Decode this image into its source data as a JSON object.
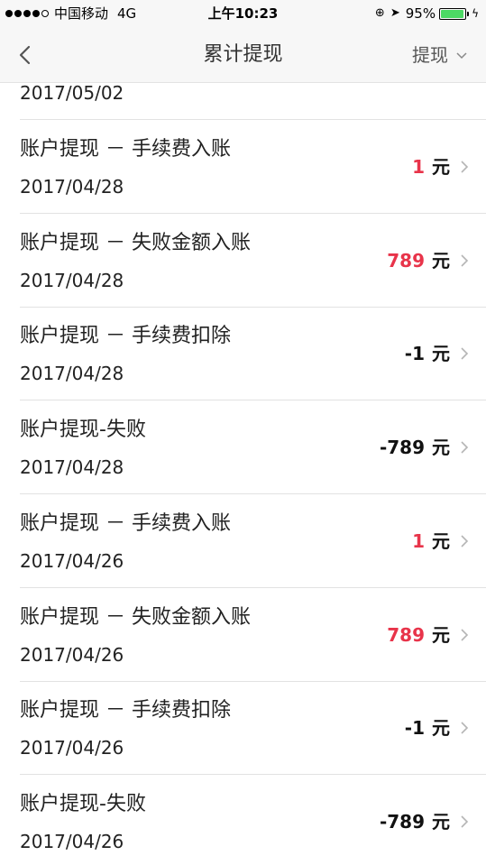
{
  "status_bar": {
    "carrier": "中国移动",
    "network": "4G",
    "time": "上午10:23",
    "battery": "95%",
    "battery_level": 0.95
  },
  "nav": {
    "title": "累计提现",
    "filter_label": "提现"
  },
  "partial_date": "2017/05/02",
  "colors": {
    "positive": "#e8344a",
    "negative": "#111111",
    "battery": "#4cd964"
  },
  "items": [
    {
      "title": "账户提现 － 手续费入账",
      "date": "2017/04/28",
      "amount": "1",
      "unit": "元",
      "sign": "pos"
    },
    {
      "title": "账户提现 － 失败金额入账",
      "date": "2017/04/28",
      "amount": "789",
      "unit": "元",
      "sign": "pos"
    },
    {
      "title": "账户提现 － 手续费扣除",
      "date": "2017/04/28",
      "amount": "-1",
      "unit": "元",
      "sign": "neg"
    },
    {
      "title": "账户提现-失败",
      "date": "2017/04/28",
      "amount": "-789",
      "unit": "元",
      "sign": "neg"
    },
    {
      "title": "账户提现 － 手续费入账",
      "date": "2017/04/26",
      "amount": "1",
      "unit": "元",
      "sign": "pos"
    },
    {
      "title": "账户提现 － 失败金额入账",
      "date": "2017/04/26",
      "amount": "789",
      "unit": "元",
      "sign": "pos"
    },
    {
      "title": "账户提现 － 手续费扣除",
      "date": "2017/04/26",
      "amount": "-1",
      "unit": "元",
      "sign": "neg"
    },
    {
      "title": "账户提现-失败",
      "date": "2017/04/26",
      "amount": "-789",
      "unit": "元",
      "sign": "neg"
    }
  ]
}
